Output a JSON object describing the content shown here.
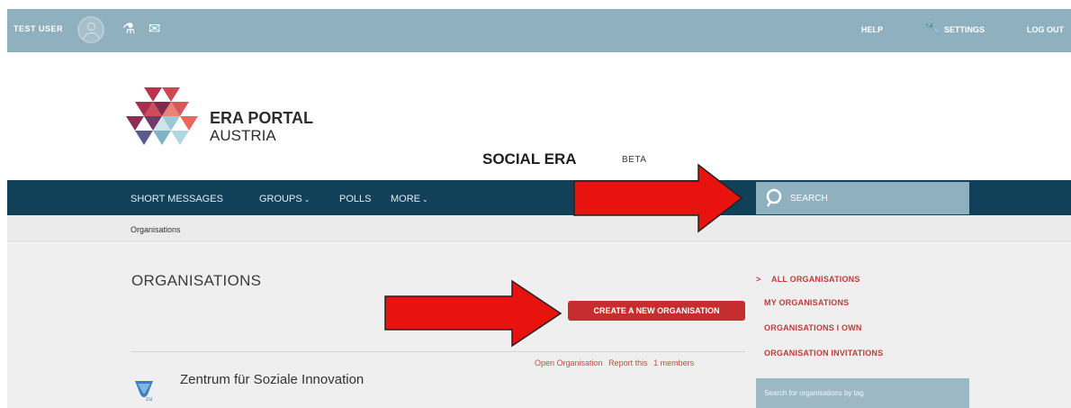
{
  "topbar": {
    "user_name": "TEST USER",
    "icons": [
      "users-icon",
      "messages-icon"
    ],
    "help": "HELP",
    "settings": "SETTINGS",
    "logout": "LOG OUT"
  },
  "header": {
    "logo_line1": "ERA PORTAL",
    "logo_line2": "AUSTRIA",
    "site_title": "SOCIAL ERA",
    "beta": "BETA"
  },
  "nav": {
    "items": [
      {
        "label": "SHORT MESSAGES"
      },
      {
        "label": "GROUPS",
        "dropdown": true
      },
      {
        "label": "POLLS"
      },
      {
        "label": "MORE",
        "dropdown": true
      }
    ],
    "search_placeholder": "SEARCH"
  },
  "breadcrumb": "Organisations",
  "main": {
    "title": "ORGANISATIONS",
    "create_button": "CREATE A NEW ORGANISATION",
    "org": {
      "actions": [
        "Open Organisation",
        "Report this",
        "1 members"
      ],
      "name": "Zentrum für Soziale Innovation"
    }
  },
  "sidebar": {
    "active_marker": ">",
    "links": [
      "ALL ORGANISATIONS",
      "MY ORGANISATIONS",
      "ORGANISATIONS I OWN",
      "ORGANISATION INVITATIONS"
    ],
    "tag_search": "Search for organisations by tag"
  },
  "colors": {
    "topbar": "#8fb0bf",
    "navbar": "#114059",
    "accent_red": "#c62d2f",
    "arrow": "#e8120e"
  }
}
